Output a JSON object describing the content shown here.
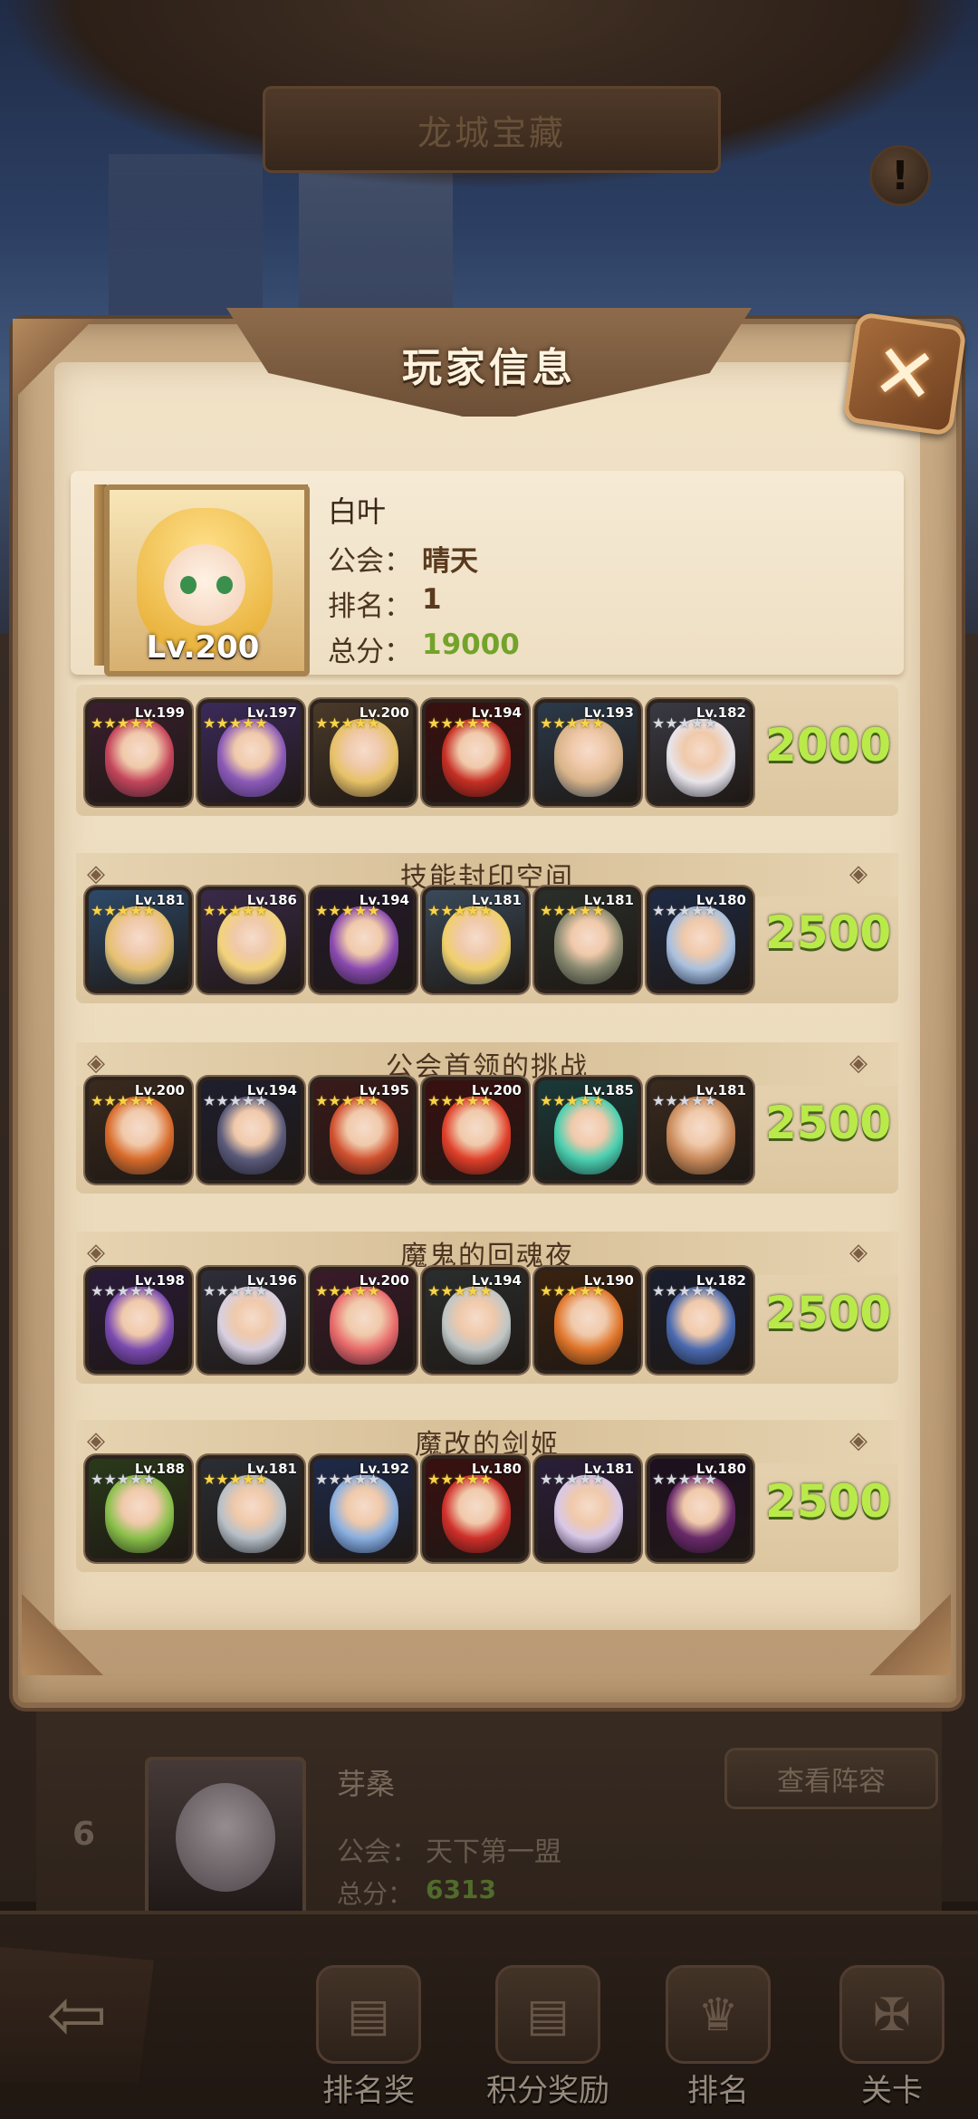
{
  "top_title": "龙城宝藏",
  "dialog_title": "玩家信息",
  "player": {
    "name": "白叶",
    "level": "Lv.200",
    "guild_label": "公会：",
    "guild": "晴天",
    "rank_label": "排名：",
    "rank": "1",
    "score_label": "总分：",
    "score": "19000"
  },
  "sections": [
    {
      "title": "",
      "score": "2000",
      "heroes": [
        {
          "lv": "Lv.199",
          "stars": "gold",
          "colors": [
            "#3a1f2e",
            "#c4455a"
          ]
        },
        {
          "lv": "Lv.197",
          "stars": "gold",
          "colors": [
            "#3b2a5a",
            "#8b5ab8"
          ]
        },
        {
          "lv": "Lv.200",
          "stars": "gold",
          "colors": [
            "#4a3a2a",
            "#e7c267"
          ]
        },
        {
          "lv": "Lv.194",
          "stars": "gold",
          "colors": [
            "#3a1010",
            "#c62f24"
          ]
        },
        {
          "lv": "Lv.193",
          "stars": "gold",
          "colors": [
            "#2b3a4a",
            "#d9b48a"
          ]
        },
        {
          "lv": "Lv.182",
          "stars": "silver",
          "colors": [
            "#3a3a44",
            "#e8e4ea"
          ]
        }
      ]
    },
    {
      "title": "技能封印空间",
      "score": "2500",
      "heroes": [
        {
          "lv": "Lv.181",
          "stars": "gold",
          "colors": [
            "#2d4a6a",
            "#e6c070"
          ]
        },
        {
          "lv": "Lv.186",
          "stars": "gold",
          "colors": [
            "#3a2a4a",
            "#f2d37a"
          ]
        },
        {
          "lv": "Lv.194",
          "stars": "gold",
          "colors": [
            "#241a2e",
            "#8a4ab0"
          ]
        },
        {
          "lv": "Lv.181",
          "stars": "gold",
          "colors": [
            "#3a4a5a",
            "#f0cf6a"
          ]
        },
        {
          "lv": "Lv.181",
          "stars": "gold",
          "colors": [
            "#2a2f2a",
            "#8a8a70"
          ]
        },
        {
          "lv": "Lv.180",
          "stars": "silver",
          "colors": [
            "#1e2a44",
            "#a9c1df"
          ]
        }
      ]
    },
    {
      "title": "公会首领的挑战",
      "score": "2500",
      "heroes": [
        {
          "lv": "Lv.200",
          "stars": "gold",
          "colors": [
            "#3a2a1e",
            "#d86a2a"
          ]
        },
        {
          "lv": "Lv.194",
          "stars": "silver",
          "colors": [
            "#1e1e2e",
            "#5a5a7a"
          ]
        },
        {
          "lv": "Lv.195",
          "stars": "gold",
          "colors": [
            "#3a1a1a",
            "#d0502e"
          ]
        },
        {
          "lv": "Lv.200",
          "stars": "gold",
          "colors": [
            "#3a1010",
            "#e0402a"
          ]
        },
        {
          "lv": "Lv.185",
          "stars": "gold",
          "colors": [
            "#1a3a3a",
            "#4ad0b0"
          ]
        },
        {
          "lv": "Lv.181",
          "stars": "silver",
          "colors": [
            "#3a2a1e",
            "#c98a5a"
          ]
        }
      ]
    },
    {
      "title": "魔鬼的回魂夜",
      "score": "2500",
      "heroes": [
        {
          "lv": "Lv.198",
          "stars": "silver",
          "colors": [
            "#2a1a3a",
            "#7a4ab0"
          ]
        },
        {
          "lv": "Lv.196",
          "stars": "silver",
          "colors": [
            "#2e2e3a",
            "#d8d0e0"
          ]
        },
        {
          "lv": "Lv.200",
          "stars": "gold",
          "colors": [
            "#3a1a2a",
            "#e86a6a"
          ]
        },
        {
          "lv": "Lv.194",
          "stars": "gold",
          "colors": [
            "#2a2e2e",
            "#c0c6c6"
          ]
        },
        {
          "lv": "Lv.190",
          "stars": "gold",
          "colors": [
            "#3a2210",
            "#e0752a"
          ]
        },
        {
          "lv": "Lv.182",
          "stars": "silver",
          "colors": [
            "#1a1e2e",
            "#4a6ab0"
          ]
        }
      ]
    },
    {
      "title": "魔改的剑姬",
      "score": "2500",
      "heroes": [
        {
          "lv": "Lv.188",
          "stars": "silver",
          "colors": [
            "#2a3a1a",
            "#8ac04a"
          ]
        },
        {
          "lv": "Lv.181",
          "stars": "gold",
          "colors": [
            "#2a2e34",
            "#b8c0c8"
          ]
        },
        {
          "lv": "Lv.192",
          "stars": "silver",
          "colors": [
            "#1e2a4a",
            "#8ab0e0"
          ]
        },
        {
          "lv": "Lv.180",
          "stars": "gold",
          "colors": [
            "#3a1010",
            "#d0302a"
          ]
        },
        {
          "lv": "Lv.181",
          "stars": "silver",
          "colors": [
            "#2a1e3a",
            "#d8c8e8"
          ]
        },
        {
          "lv": "Lv.180",
          "stars": "silver",
          "colors": [
            "#1e1020",
            "#6a2a6a"
          ]
        }
      ]
    }
  ],
  "background_entry": {
    "rank": "6",
    "name": "芽桑",
    "guild_label": "公会：",
    "guild": "天下第一盟",
    "score_label": "总分：",
    "score": "6313",
    "view_button": "查看阵容"
  },
  "nav": {
    "items": [
      {
        "label": "排名奖",
        "icon": "scroll-icon"
      },
      {
        "label": "积分奖励",
        "icon": "scroll-icon"
      },
      {
        "label": "排名",
        "icon": "rank-icon"
      },
      {
        "label": "关卡",
        "icon": "stage-icon"
      }
    ]
  },
  "colors": {
    "score_green": "#b9ea4a",
    "gold_star": "#f7d34b",
    "panel_bg": "#f1e2c7"
  }
}
